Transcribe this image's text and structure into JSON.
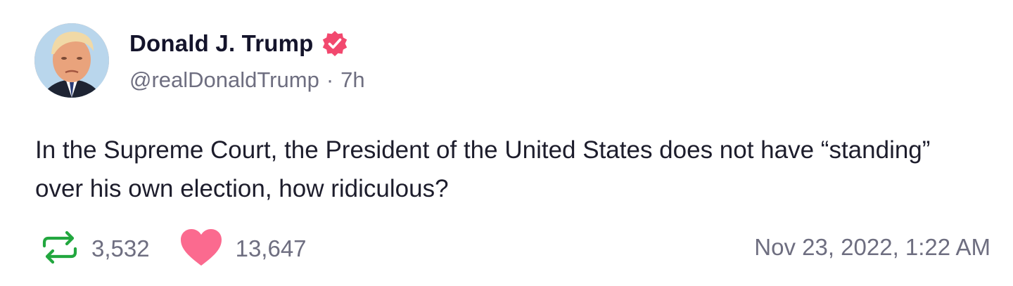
{
  "author": {
    "display_name": "Donald J. Trump",
    "handle": "@realDonaldTrump",
    "separator": "·",
    "age": "7h",
    "verified": true
  },
  "post": {
    "text": "In the Supreme Court, the President of the United States does not have “standing” over his own election, how ridiculous?"
  },
  "stats": {
    "reposts": "3,532",
    "likes": "13,647"
  },
  "timestamp": "Nov 23, 2022, 1:22 AM",
  "icons": {
    "verified": "verified-badge-icon",
    "repost": "repost-icon",
    "like": "heart-icon"
  },
  "colors": {
    "verified": "#f2486e",
    "repost": "#22a73f",
    "like": "#fb6a8f",
    "muted": "#6e6e80"
  }
}
